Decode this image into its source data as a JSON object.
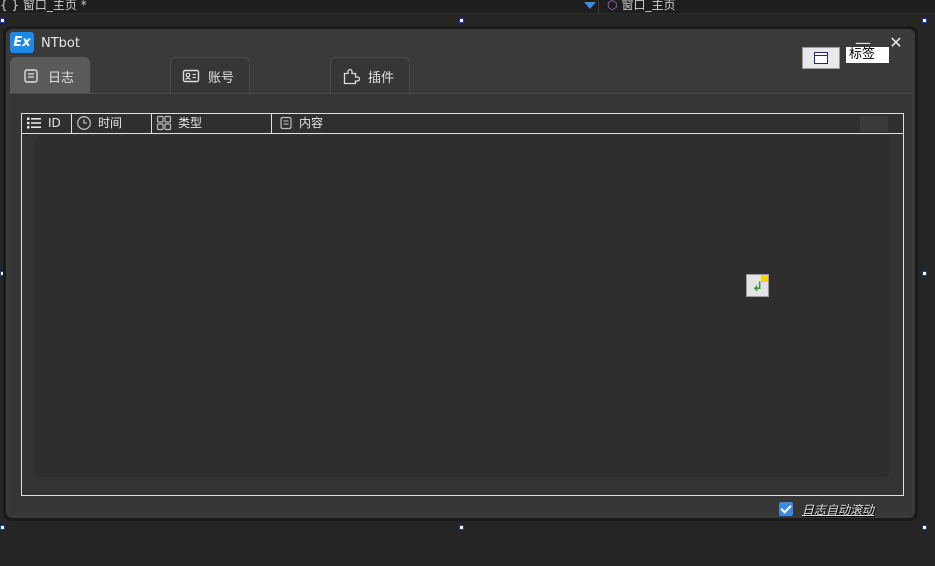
{
  "ide": {
    "left_tab": "{ } 窗口_主页 *",
    "right_tab": "窗口_主页"
  },
  "window": {
    "app_icon_text": "Ex",
    "title": "NTbot",
    "minimize": "—",
    "close": "✕"
  },
  "tabs": [
    {
      "label": "日志",
      "icon": "document-icon",
      "active": true
    },
    {
      "label": "账号",
      "icon": "id-card-icon",
      "active": false
    },
    {
      "label": "插件",
      "icon": "puzzle-icon",
      "active": false
    }
  ],
  "label_control": {
    "text": "标签"
  },
  "log_table": {
    "columns": [
      {
        "label": "ID",
        "icon": "list-icon"
      },
      {
        "label": "时间",
        "icon": "clock-icon"
      },
      {
        "label": "类型",
        "icon": "grid-icon"
      },
      {
        "label": "内容",
        "icon": "note-icon"
      }
    ],
    "rows": []
  },
  "auto_scroll": {
    "label": "日志自动滚动",
    "checked": true
  },
  "colors": {
    "accent": "#3b8be0",
    "app_icon": "#1e88e5",
    "window_bg": "#3a3a3a"
  }
}
